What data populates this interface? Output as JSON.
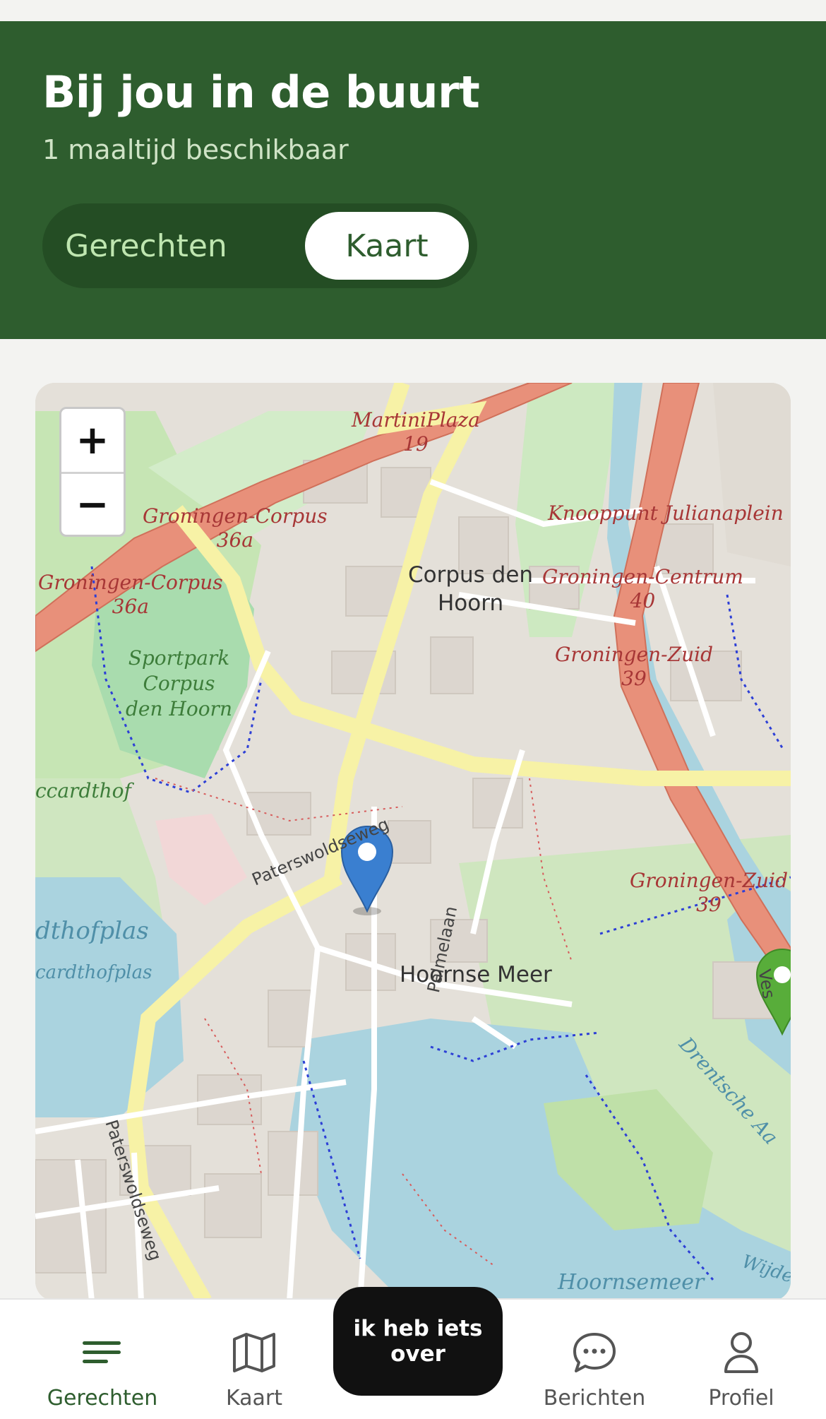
{
  "header": {
    "title": "Bij jou in de buurt",
    "subtitle": "1 maaltijd beschikbaar",
    "tabs": [
      {
        "label": "Gerechten",
        "active": false
      },
      {
        "label": "Kaart",
        "active": true
      }
    ]
  },
  "map": {
    "zoom_in": "+",
    "zoom_out": "−",
    "labels": {
      "martiniplaza": "MartiniPlaza",
      "martiniplaza_num": "19",
      "knooppunt": "Knooppunt Julianaplein",
      "groningen_corpus": "Groningen-Corpus",
      "groningen_corpus_num": "36a",
      "groningen_corpus2": "Groningen-Corpus",
      "groningen_corpus2_num": "36a",
      "corpus_den_hoorn_1": "Corpus den",
      "corpus_den_hoorn_2": "Hoorn",
      "groningen_centrum": "Groningen-Centrum",
      "groningen_centrum_num": "40",
      "groningen_zuid": "Groningen-Zuid",
      "groningen_zuid_num": "39",
      "groningen_zuid2": "Groningen-Zuid",
      "groningen_zuid2_num": "39",
      "sportpark_1": "Sportpark",
      "sportpark_2": "Corpus",
      "sportpark_3": "den Hoorn",
      "ccardthof": "ccardthof",
      "dthofplas": "dthofplas",
      "cardthofplas": "cardthofplas",
      "hoornse_meer": "Hoornse Meer",
      "paterswoldseweg": "Paterswoldseweg",
      "paterswoldseweg2": "Paterswoldseweg",
      "palmelaan": "Palmelaan",
      "drentsche_aa": "Drentsche Aa",
      "hoornsemeer": "Hoornsemeer",
      "wijde": "Wijde",
      "ves": "Ves"
    },
    "colors": {
      "user_pin": "#3a7fd0",
      "meal_pin": "#58ad3a"
    }
  },
  "nav": {
    "items": [
      {
        "label": "Gerechten",
        "icon": "menu-lines-icon",
        "active": true
      },
      {
        "label": "Kaart",
        "icon": "map-icon",
        "active": false
      },
      {
        "label": "Berichten",
        "icon": "chat-bubble-icon",
        "active": false
      },
      {
        "label": "Profiel",
        "icon": "person-icon",
        "active": false
      }
    ],
    "cta_label": "ik heb iets over"
  },
  "colors": {
    "header_bg": "#2e5d2e",
    "accent": "#2e5d2e"
  }
}
